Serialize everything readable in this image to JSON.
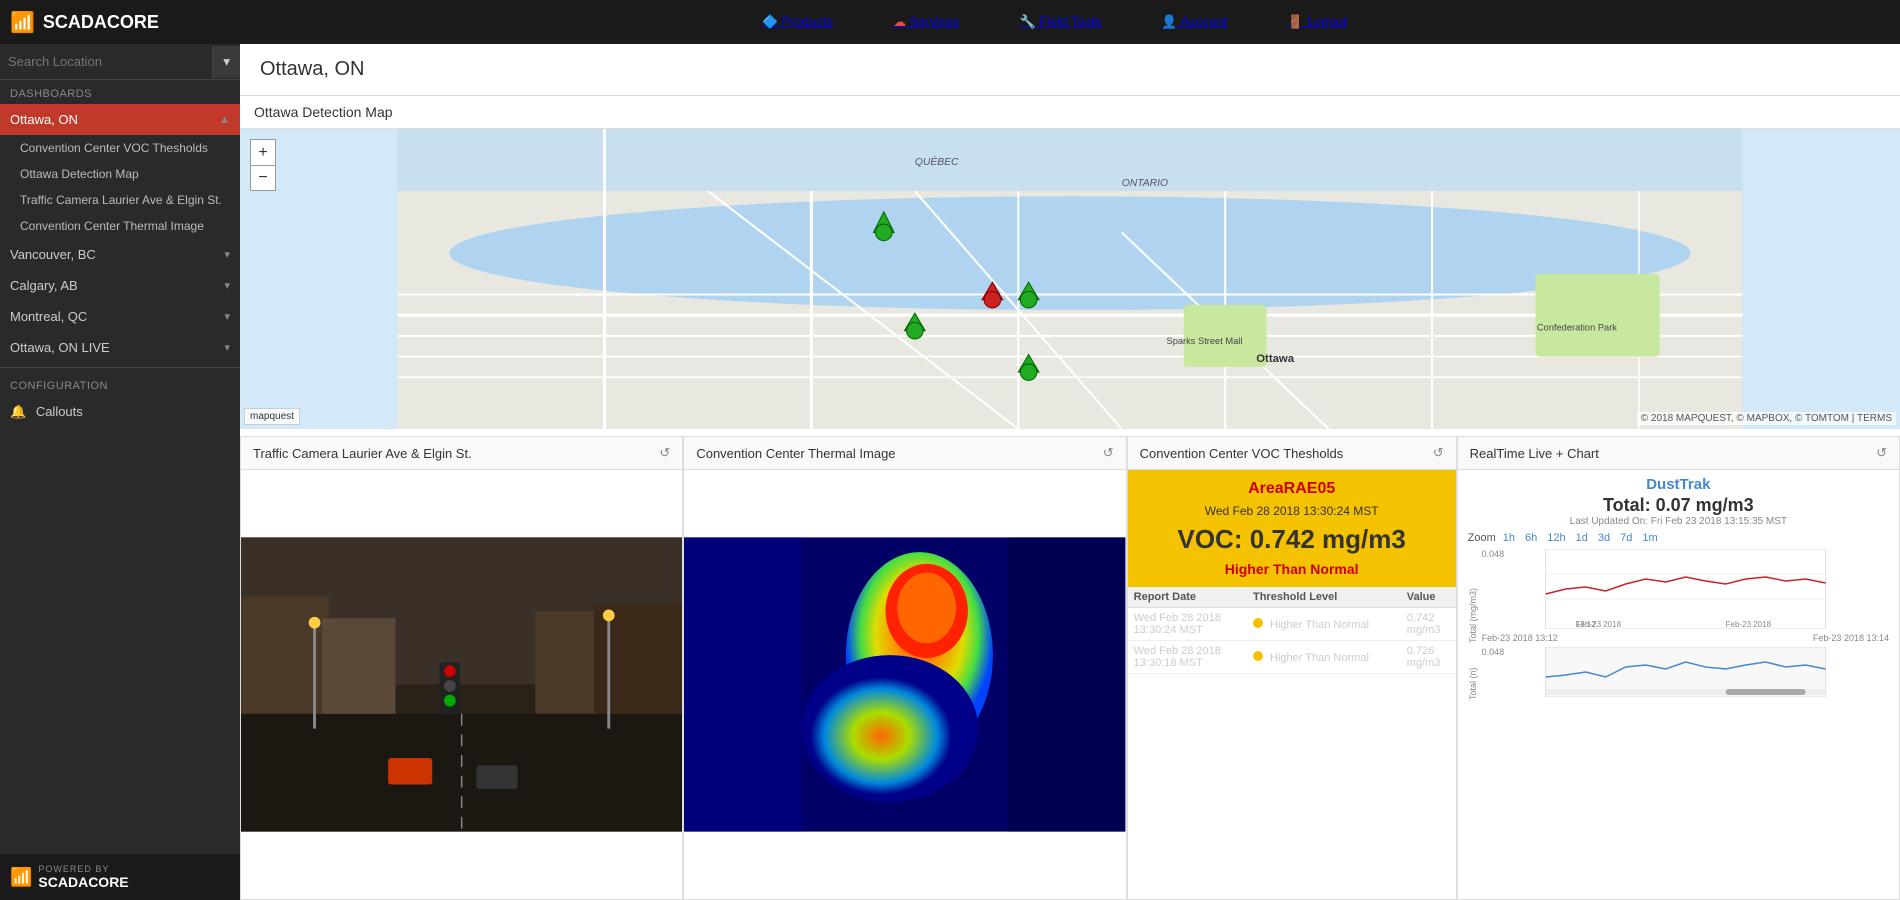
{
  "topnav": {
    "logo": "SCADACORE",
    "nav_items": [
      {
        "label": "Products",
        "icon": "🔴"
      },
      {
        "label": "Services",
        "icon": "🔴"
      },
      {
        "label": "Field Tools",
        "icon": "🔧"
      },
      {
        "label": "Account",
        "icon": "👤"
      },
      {
        "label": "Logout",
        "icon": "🚪"
      }
    ]
  },
  "sidebar": {
    "search_placeholder": "Search Location",
    "section_dashboards": "DASHBOARDS",
    "section_configuration": "CONFIGURATION",
    "active_item": "Ottawa, ON",
    "items": [
      {
        "label": "Ottawa, ON",
        "active": true,
        "subitems": [
          "Convention Center VOC Thesholds",
          "Ottawa Detection Map",
          "Traffic Camera Laurier Ave & Elgin St.",
          "Convention Center Thermal Image"
        ]
      },
      {
        "label": "Vancouver, BC",
        "active": false
      },
      {
        "label": "Calgary, AB",
        "active": false
      },
      {
        "label": "Montreal, QC",
        "active": false
      },
      {
        "label": "Ottawa, ON LIVE",
        "active": false
      }
    ],
    "callouts_label": "Callouts"
  },
  "page": {
    "title": "Ottawa, ON"
  },
  "map": {
    "title": "Ottawa Detection Map",
    "zoom_in": "+",
    "zoom_out": "−",
    "attribution": "© 2018 MAPQUEST, © MAPBOX, © TOMTOM | TERMS"
  },
  "panels": {
    "traffic_cam": {
      "title": "Traffic Camera Laurier Ave & Elgin St.",
      "icon": "↺"
    },
    "thermal": {
      "title": "Convention Center Thermal Image",
      "icon": "↺"
    },
    "voc": {
      "title": "Convention Center VOC Thesholds",
      "icon": "↺",
      "sensor_name": "AreaRAE05",
      "datetime": "Wed Feb 28 2018 13:30:24 MST",
      "voc_label": "VOC:",
      "voc_value": "0.742 mg/m3",
      "status": "Higher Than Normal",
      "table_headers": [
        "Report Date",
        "Threshold Level",
        "Value"
      ],
      "table_rows": [
        {
          "date": "Wed Feb 28 2018",
          "time": "13:30:24 MST",
          "threshold": "Higher Than Normal",
          "value": "0.742",
          "unit": "mg/m3"
        },
        {
          "date": "Wed Feb 28 2018",
          "time": "13:30:18 MST",
          "threshold": "Higher Than Normal",
          "value": "0.726",
          "unit": "mg/m3"
        }
      ]
    },
    "realtime": {
      "title": "RealTime Live + Chart",
      "icon": "↺",
      "chart_title": "DustTrak",
      "total_label": "Total:",
      "total_value": "0.07 mg/m3",
      "last_updated": "Last Updated On: Fri Feb 23 2018 13:15:35 MST",
      "zoom_label": "Zoom",
      "zoom_options": [
        "1h",
        "6h",
        "12h",
        "1d",
        "3d",
        "7d",
        "1m"
      ],
      "y_label_top": "0.048",
      "y_label_bottom": "0.048",
      "x_labels": [
        "Feb-23 2018 13:12",
        "Feb-23 2018 13:14"
      ],
      "chart_y_axis": "Total (mg/m3)"
    }
  }
}
